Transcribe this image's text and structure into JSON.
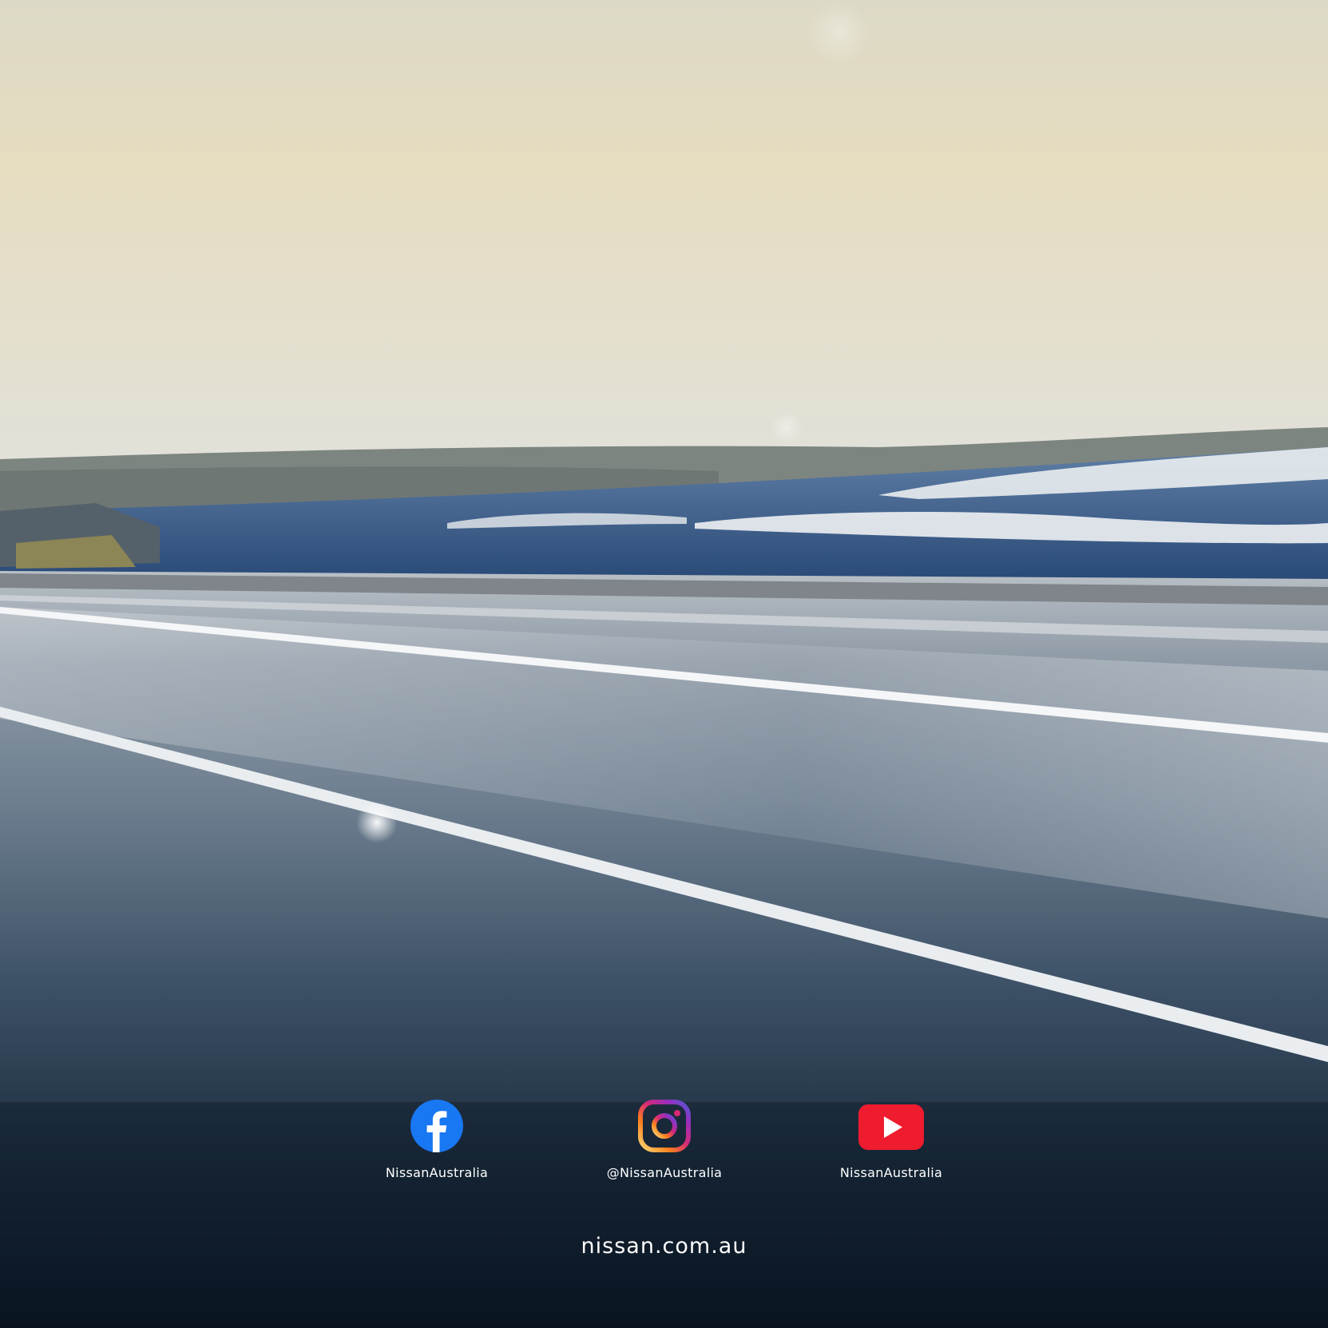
{
  "colors": {
    "facebook": "#1877f2",
    "youtube": "#ee1c2e",
    "text": "#ffffff"
  },
  "social": [
    {
      "network": "facebook",
      "icon": "facebook-icon",
      "handle": "NissanAustralia"
    },
    {
      "network": "instagram",
      "icon": "instagram-icon",
      "handle": "@NissanAustralia"
    },
    {
      "network": "youtube",
      "icon": "youtube-icon",
      "handle": "NissanAustralia"
    }
  ],
  "website": "nissan.com.au"
}
